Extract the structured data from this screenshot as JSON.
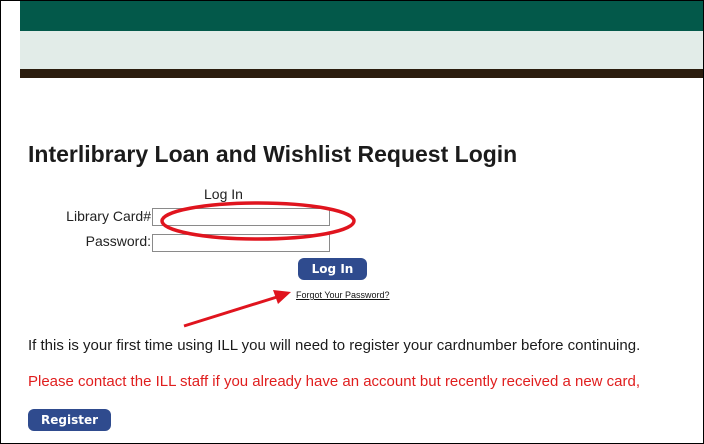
{
  "page": {
    "title": "Interlibrary Loan and Wishlist Request Login"
  },
  "login": {
    "heading": "Log In",
    "card_label": "Library Card#",
    "card_value": "",
    "password_label": "Password:",
    "password_value": "",
    "login_button": "Log In",
    "forgot_link": "Forgot Your Password?"
  },
  "info": {
    "first_time": "If this is your first time using ILL you will need to register your cardnumber before continuing.",
    "contact": "Please contact the ILL staff if you already have an account but recently received a new card,",
    "register_button": "Register"
  },
  "theme": {
    "header_green": "#03594a",
    "header_light": "#e2ece8",
    "header_dark": "#2b1d0e",
    "button_blue": "#2f4b8e",
    "warning_red": "#e01e1e",
    "annotation_red": "#e0141e"
  }
}
